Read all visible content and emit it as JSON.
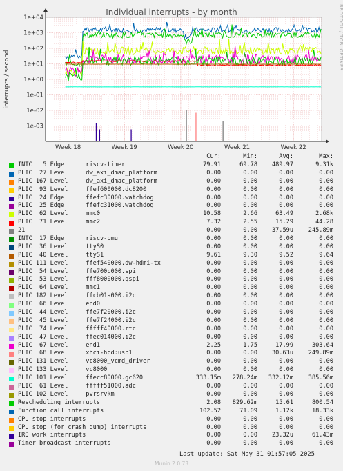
{
  "chart_data": {
    "type": "line",
    "title": "Individual interrupts - by month",
    "ylabel": "interrupts / second",
    "yscale": "log",
    "ylim": [
      0.0001,
      10000
    ],
    "ytick_labels": [
      "1e-03",
      "1e-02",
      "1e-01",
      "1e+00",
      "1e+01",
      "1e+02",
      "1e+03",
      "1e+04"
    ],
    "x_tick_labels": [
      "Week 18",
      "Week 19",
      "Week 20",
      "Week 21",
      "Week 22"
    ],
    "x_tick_weeks": [
      18,
      19,
      20,
      21,
      22
    ],
    "xlim_weeks": [
      17.6,
      22.5
    ],
    "grid": true,
    "series": [
      {
        "name": "INTC   5 Edge      riscv-timer",
        "color": "#00cc00",
        "cur": "79.91",
        "min": "69.78",
        "avg": "489.97",
        "max": "9.31k"
      },
      {
        "name": "PLIC  27 Level     dw_axi_dmac_platform",
        "color": "#0066b3",
        "cur": "0.00",
        "min": "0.00",
        "avg": "0.00",
        "max": "0.00"
      },
      {
        "name": "PLIC 167 Level     dw_axi_dmac_platform",
        "color": "#ff8000",
        "cur": "0.00",
        "min": "0.00",
        "avg": "0.00",
        "max": "0.00"
      },
      {
        "name": "PLIC  93 Level     ffef600000.dc8200",
        "color": "#ffcc00",
        "cur": "0.00",
        "min": "0.00",
        "avg": "0.00",
        "max": "0.00"
      },
      {
        "name": "PLIC  24 Edge      ffefc30000.watchdog",
        "color": "#330099",
        "cur": "0.00",
        "min": "0.00",
        "avg": "0.00",
        "max": "0.00"
      },
      {
        "name": "PLIC  25 Edge      ffefc31000.watchdog",
        "color": "#990099",
        "cur": "0.00",
        "min": "0.00",
        "avg": "0.00",
        "max": "0.00"
      },
      {
        "name": "PLIC  62 Level     mmc0",
        "color": "#ccff00",
        "cur": "10.58",
        "min": "2.66",
        "avg": "63.49",
        "max": "2.68k"
      },
      {
        "name": "PLIC  71 Level     mmc2",
        "color": "#ff0000",
        "cur": "7.32",
        "min": "2.55",
        "avg": "15.29",
        "max": "44.28"
      },
      {
        "name": "21",
        "color": "#808080",
        "cur": "0.00",
        "min": "0.00",
        "avg": "37.59u",
        "max": "245.89m"
      },
      {
        "name": "INTC  17 Edge      riscv-pmu",
        "color": "#008f00",
        "cur": "0.00",
        "min": "0.00",
        "avg": "0.00",
        "max": "0.00"
      },
      {
        "name": "PLIC  36 Level     ttyS0",
        "color": "#00487d",
        "cur": "0.00",
        "min": "0.00",
        "avg": "0.00",
        "max": "0.00"
      },
      {
        "name": "PLIC  40 Level     ttyS1",
        "color": "#b35a00",
        "cur": "9.61",
        "min": "9.30",
        "avg": "9.52",
        "max": "9.64"
      },
      {
        "name": "PLIC 111 Level     ffef540000.dw-hdmi-tx",
        "color": "#b38f00",
        "cur": "0.00",
        "min": "0.00",
        "avg": "0.00",
        "max": "0.00"
      },
      {
        "name": "PLIC  54 Level     ffe700c000.spi",
        "color": "#6b006b",
        "cur": "0.00",
        "min": "0.00",
        "avg": "0.00",
        "max": "0.00"
      },
      {
        "name": "PLIC  53 Level     fff8000000.qspi",
        "color": "#8fb300",
        "cur": "0.00",
        "min": "0.00",
        "avg": "0.00",
        "max": "0.00"
      },
      {
        "name": "PLIC  64 Level     mmc1",
        "color": "#b30000",
        "cur": "0.00",
        "min": "0.00",
        "avg": "0.00",
        "max": "0.00"
      },
      {
        "name": "PLIC 182 Level     ffcb01a000.i2c",
        "color": "#bebebe",
        "cur": "0.00",
        "min": "0.00",
        "avg": "0.00",
        "max": "0.00"
      },
      {
        "name": "PLIC  66 Level     end0",
        "color": "#80ff80",
        "cur": "0.00",
        "min": "0.00",
        "avg": "0.00",
        "max": "0.00"
      },
      {
        "name": "PLIC  44 Level     ffe7f20000.i2c",
        "color": "#80c9ff",
        "cur": "0.00",
        "min": "0.00",
        "avg": "0.00",
        "max": "0.00"
      },
      {
        "name": "PLIC  45 Level     ffe7f24000.i2c",
        "color": "#ffc080",
        "cur": "0.00",
        "min": "0.00",
        "avg": "0.00",
        "max": "0.00"
      },
      {
        "name": "PLIC  74 Level     fffff40000.rtc",
        "color": "#ffe680",
        "cur": "0.00",
        "min": "0.00",
        "avg": "0.00",
        "max": "0.00"
      },
      {
        "name": "PLIC  47 Level     ffec014000.i2c",
        "color": "#aa80ff",
        "cur": "0.00",
        "min": "0.00",
        "avg": "0.00",
        "max": "0.00"
      },
      {
        "name": "PLIC  67 Level     end1",
        "color": "#ee00cc",
        "cur": "2.25",
        "min": "1.75",
        "avg": "17.99",
        "max": "303.64"
      },
      {
        "name": "PLIC  68 Level     xhci-hcd:usb1",
        "color": "#ff8080",
        "cur": "0.00",
        "min": "0.00",
        "avg": "30.63u",
        "max": "249.89m"
      },
      {
        "name": "PLIC 131 Level     vc8000_vcmd_driver",
        "color": "#666600",
        "cur": "0.00",
        "min": "0.00",
        "avg": "0.00",
        "max": "0.00"
      },
      {
        "name": "PLIC 133 Level     vc8000",
        "color": "#ffbfff",
        "cur": "0.00",
        "min": "0.00",
        "avg": "0.00",
        "max": "0.00"
      },
      {
        "name": "PLIC 101 Level     ffecc80000.gc620",
        "color": "#00ffcc",
        "cur": "333.15m",
        "min": "278.24m",
        "avg": "332.12m",
        "max": "385.56m"
      },
      {
        "name": "PLIC  61 Level     fffff51000.adc",
        "color": "#cc6699",
        "cur": "0.00",
        "min": "0.00",
        "avg": "0.00",
        "max": "0.00"
      },
      {
        "name": "PLIC 102 Level     pvrsrvkm",
        "color": "#999900",
        "cur": "0.00",
        "min": "0.00",
        "avg": "0.00",
        "max": "0.00"
      },
      {
        "name": "Rescheduling interrupts",
        "color": "#00cc00",
        "cur": "2.08",
        "min": "829.62m",
        "avg": "15.61",
        "max": "800.54"
      },
      {
        "name": "Function call interrupts",
        "color": "#0066b3",
        "cur": "102.52",
        "min": "71.09",
        "avg": "1.12k",
        "max": "18.33k"
      },
      {
        "name": "CPU stop interrupts",
        "color": "#ff8000",
        "cur": "0.00",
        "min": "0.00",
        "avg": "0.00",
        "max": "0.00"
      },
      {
        "name": "CPU stop (for crash dump) interrupts",
        "color": "#ffcc00",
        "cur": "0.00",
        "min": "0.00",
        "avg": "0.00",
        "max": "0.00"
      },
      {
        "name": "IRQ work interrupts",
        "color": "#330099",
        "cur": "0.00",
        "min": "0.00",
        "avg": "23.32u",
        "max": "61.43m"
      },
      {
        "name": "Timer broadcast interrupts",
        "color": "#990099",
        "cur": "0.00",
        "min": "0.00",
        "avg": "0.00",
        "max": "0.00"
      }
    ]
  },
  "legend_header": {
    "cur": "Cur:",
    "min": "Min:",
    "avg": "Avg:",
    "max": "Max:"
  },
  "side_label": "RRDTOOL / TOBI OETIKER",
  "footer": {
    "last_update": "Last update: Sat May 31 01:57:05 2025",
    "munin": "Munin 2.0.73"
  }
}
